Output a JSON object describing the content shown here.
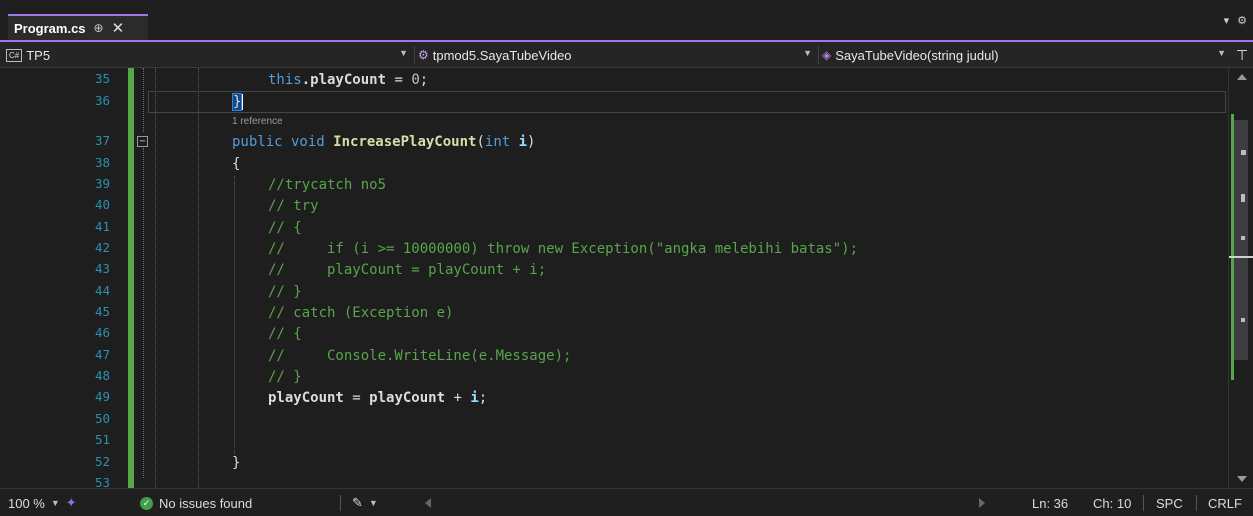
{
  "tab": {
    "title": "Program.cs",
    "pin_glyph": "⊕",
    "close_glyph": "✕"
  },
  "tabstrip_controls": {
    "dropdown": "▾",
    "settings": "⚙"
  },
  "navbar": {
    "project_badge": "C#",
    "project": "TP5",
    "class": "tpmod5.SayaTubeVideo",
    "member": "SayaTubeVideo(string judul)"
  },
  "editor": {
    "line_numbers": [
      "35",
      "36",
      "37",
      "38",
      "39",
      "40",
      "41",
      "42",
      "43",
      "44",
      "45",
      "46",
      "47",
      "48",
      "49",
      "50",
      "51",
      "52",
      "53"
    ],
    "reference_lens": "1 reference",
    "code": {
      "l35_this": "this",
      "l35_rest": ".playCount",
      "l35_eq": " = ",
      "l35_num": "0",
      "l35_end": ";",
      "l36": "}",
      "l37_kw": "public void ",
      "l37_name": "IncreasePlayCount",
      "l37_open": "(",
      "l37_type": "int ",
      "l37_param": "i",
      "l37_close": ")",
      "l38": "{",
      "l39": "//trycatch no5",
      "l40": "// try",
      "l41": "// {",
      "l42": "//     if (i >= 10000000) throw new Exception(\"angka melebihi batas\");",
      "l43": "//     playCount = playCount + i;",
      "l44": "// }",
      "l45": "// catch (Exception e)",
      "l46": "// {",
      "l47": "//     Console.WriteLine(e.Message);",
      "l48": "// }",
      "l49_a": "playCount",
      "l49_b": " = ",
      "l49_c": "playCount",
      "l49_d": " + ",
      "l49_e": "i",
      "l49_f": ";",
      "l52": "}"
    }
  },
  "statusbar": {
    "zoom": "100 %",
    "issues": "No issues found",
    "ln": "Ln: 36",
    "ch": "Ch: 10",
    "spc": "SPC",
    "crlf": "CRLF"
  },
  "colors": {
    "accent": "#9d7ae6",
    "keyword": "#569cd6",
    "comment": "#57a64a",
    "line_number": "#2b91af",
    "method": "#dcdcaa",
    "change_bar": "#57a64a"
  }
}
